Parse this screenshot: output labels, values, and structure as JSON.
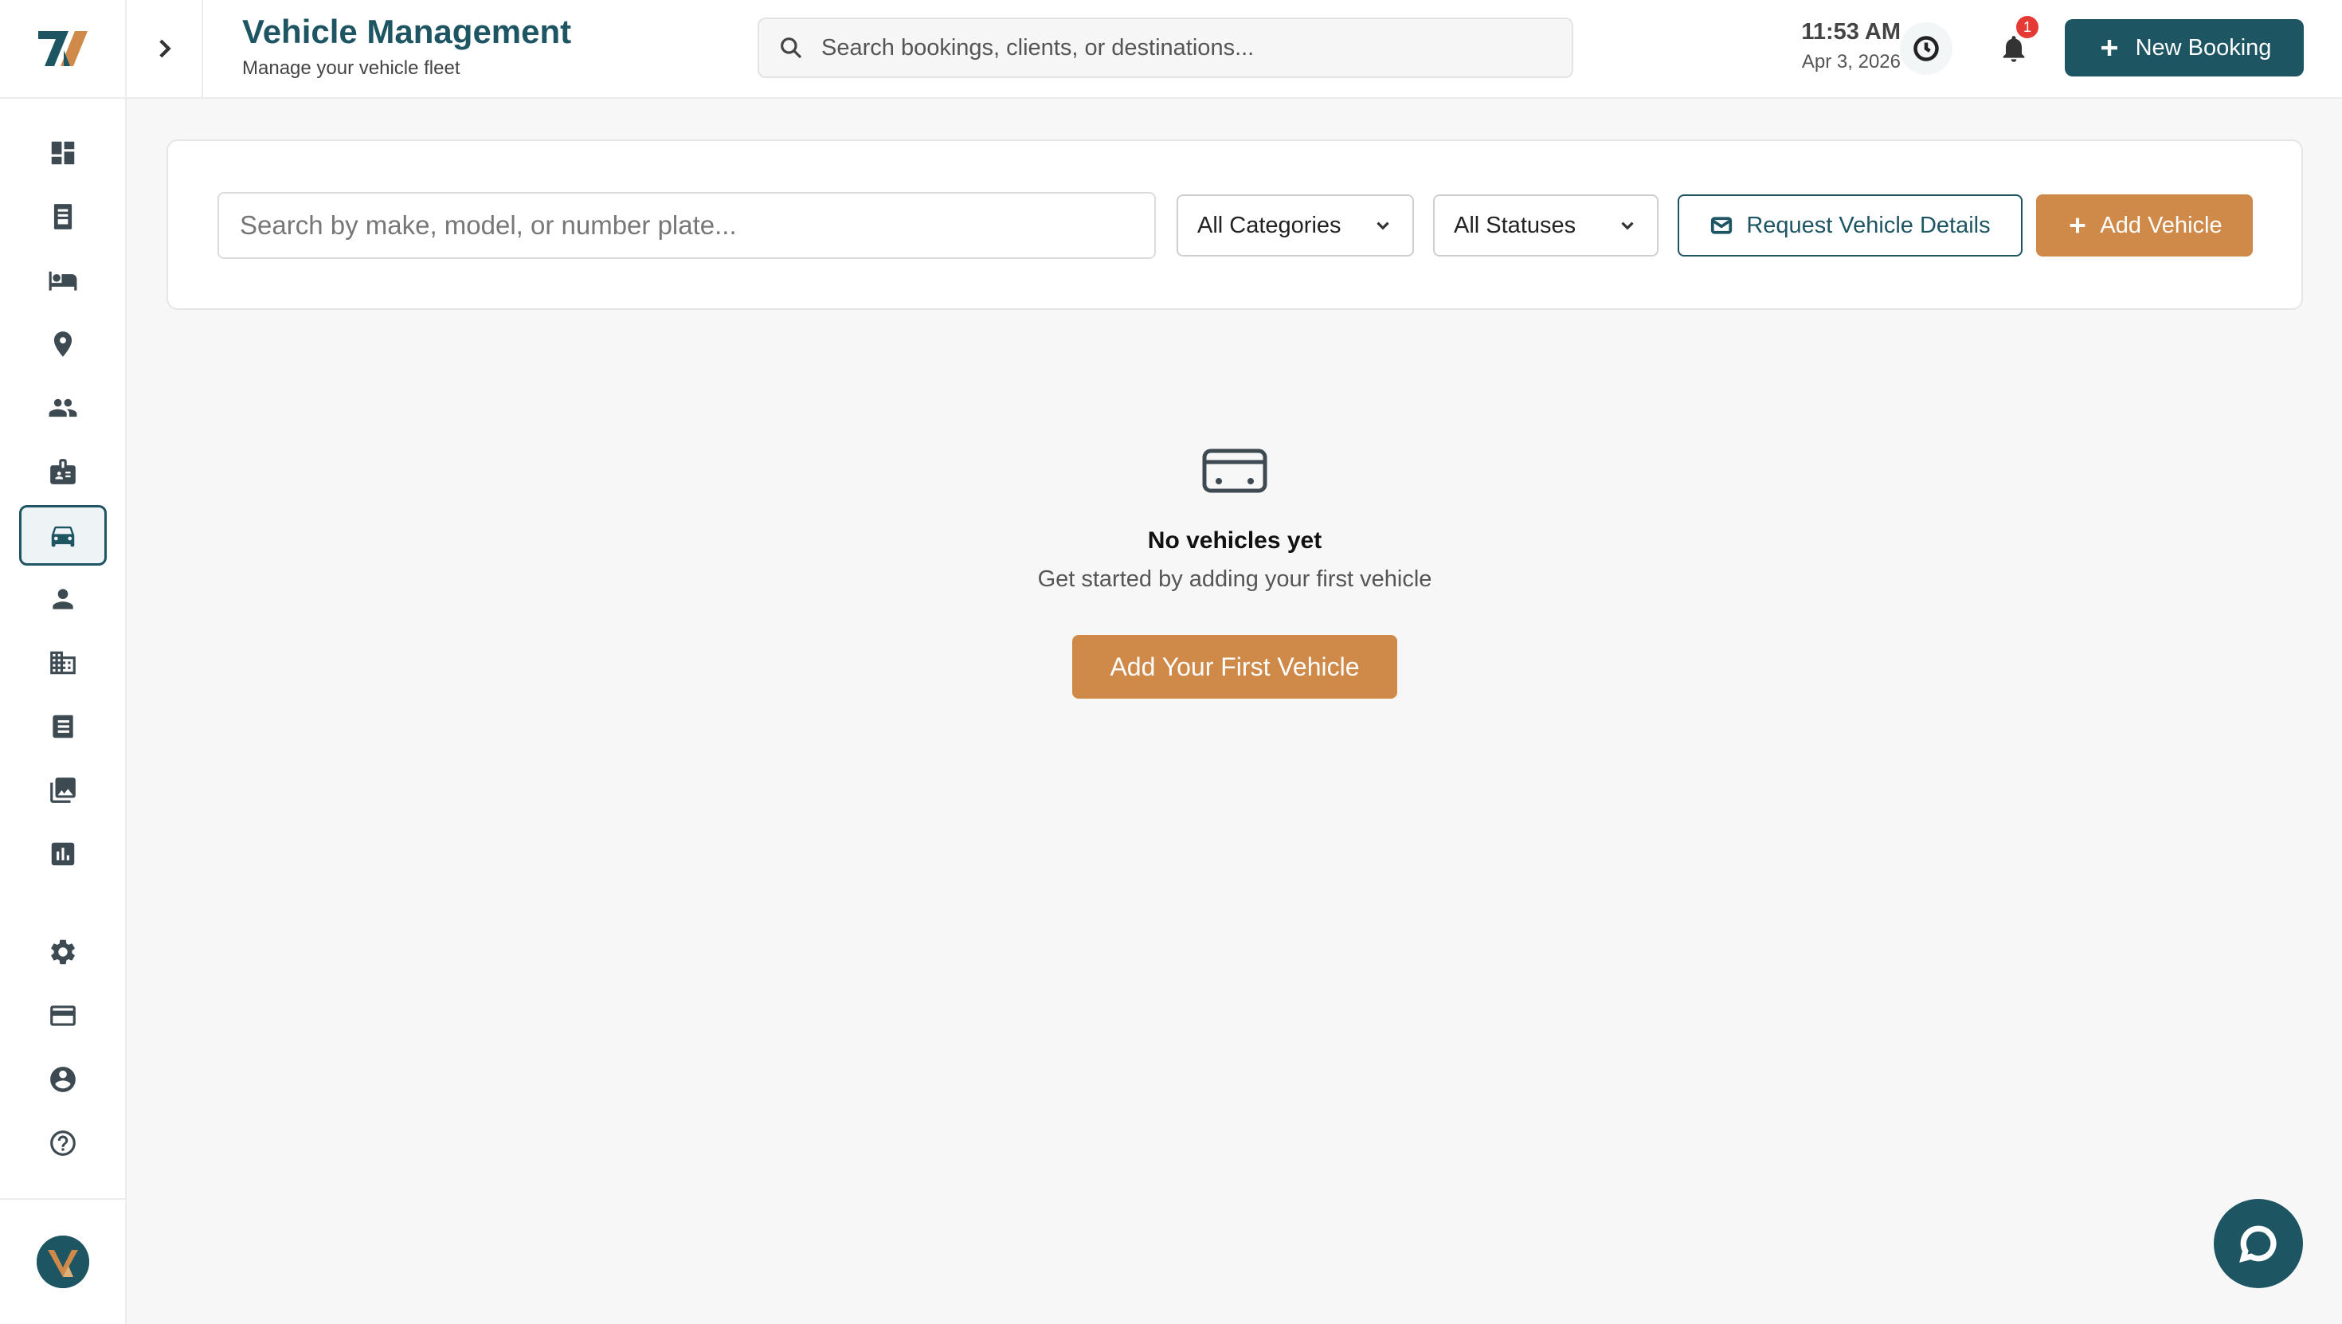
{
  "header": {
    "title": "Vehicle Management",
    "subtitle": "Manage your vehicle fleet",
    "search_placeholder": "Search bookings, clients, or destinations...",
    "time": "11:53 AM",
    "date": "Apr 3, 2026",
    "notification_count": "1",
    "new_booking_label": "New Booking"
  },
  "sidebar": {
    "items": [
      {
        "icon": "dashboard-icon"
      },
      {
        "icon": "receipt-icon"
      },
      {
        "icon": "bed-icon"
      },
      {
        "icon": "location-pin-icon"
      },
      {
        "icon": "group-icon"
      },
      {
        "icon": "id-badge-icon"
      },
      {
        "icon": "car-icon",
        "active": true
      },
      {
        "icon": "person-icon"
      },
      {
        "icon": "building-icon"
      },
      {
        "icon": "document-icon"
      },
      {
        "icon": "photo-library-icon"
      },
      {
        "icon": "bar-chart-icon"
      },
      {
        "icon": "gear-icon"
      },
      {
        "icon": "credit-card-icon"
      },
      {
        "icon": "account-circle-icon"
      },
      {
        "icon": "help-icon"
      }
    ]
  },
  "toolbar": {
    "search_placeholder": "Search by make, model, or number plate...",
    "category_select": "All Categories",
    "status_select": "All Statuses",
    "request_label": "Request Vehicle Details",
    "add_label": "Add Vehicle"
  },
  "empty_state": {
    "title": "No vehicles yet",
    "text": "Get started by adding your first vehicle",
    "button_label": "Add Your First Vehicle"
  },
  "colors": {
    "primary": "#1e5563",
    "accent": "#cf8a4a",
    "badge": "#e53935"
  }
}
